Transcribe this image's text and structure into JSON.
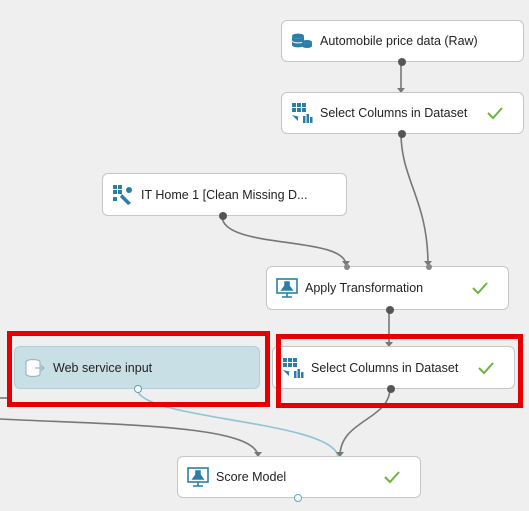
{
  "nodes": {
    "automobile_data": {
      "label": "Automobile price data (Raw)",
      "icon": "database-icon"
    },
    "select_columns_top": {
      "label": "Select Columns in Dataset",
      "icon": "select-columns-icon",
      "status": "check-icon"
    },
    "it_home": {
      "label": "IT Home 1 [Clean Missing D...",
      "icon": "transform-icon"
    },
    "apply_transformation": {
      "label": "Apply Transformation",
      "icon": "apply-transform-icon",
      "status": "check-icon"
    },
    "web_service_input": {
      "label": "Web service input",
      "icon": "web-service-input-icon"
    },
    "select_columns_bottom": {
      "label": "Select Columns in Dataset",
      "icon": "select-columns-icon",
      "status": "check-icon"
    },
    "score_model": {
      "label": "Score Model",
      "icon": "score-model-icon",
      "status": "check-icon"
    }
  },
  "colors": {
    "canvas": "#efefef",
    "highlight": "#e40000",
    "check": "#6cb33f",
    "icon": "#2b7ea7",
    "selected_node": "#c9dfe6"
  }
}
